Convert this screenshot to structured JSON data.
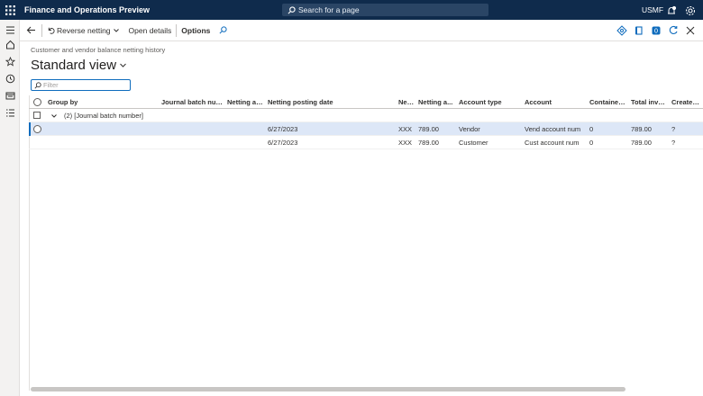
{
  "topbar": {
    "app_title": "Finance and Operations Preview",
    "search_placeholder": "Search for a page",
    "company": "USMF"
  },
  "actions": {
    "reverse_netting": "Reverse netting",
    "open_details": "Open details",
    "options": "Options"
  },
  "page": {
    "caption": "Customer and vendor balance netting history",
    "view_title": "Standard view",
    "filter_placeholder": "Filter"
  },
  "grid": {
    "columns": [
      "Group by",
      "Journal batch num...",
      "Netting ag...",
      "Netting posting date",
      "Net...",
      "Netting a...",
      "Account type",
      "Account",
      "Contained ...",
      "Total invoi...",
      "Created by"
    ],
    "group_label": "(2) [Journal batch number]",
    "rows": [
      {
        "date": "6/27/2023",
        "currency": "XXX",
        "amount": "789.00",
        "account_type": "Vendor",
        "account": "Vend account num",
        "contained": "0",
        "total": "789.00",
        "created_by": "?"
      },
      {
        "date": "6/27/2023",
        "currency": "XXX",
        "amount": "789.00",
        "account_type": "Customer",
        "account": "Cust account num",
        "contained": "0",
        "total": "789.00",
        "created_by": "?"
      }
    ]
  }
}
